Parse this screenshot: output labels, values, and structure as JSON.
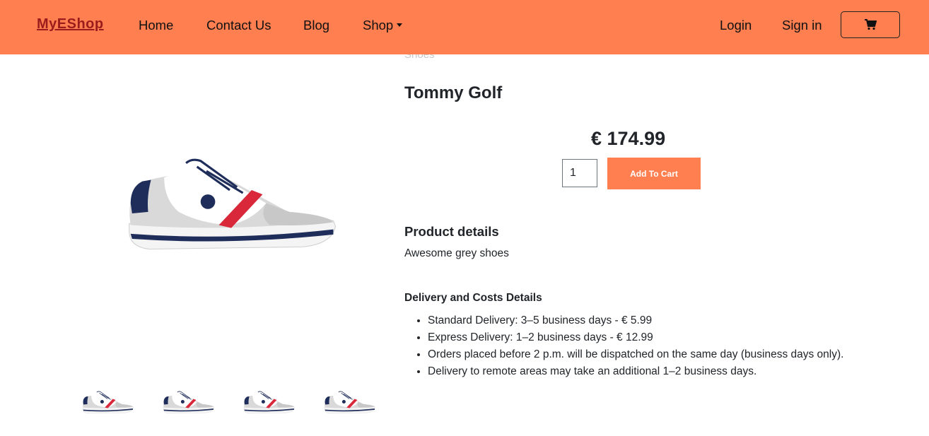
{
  "nav": {
    "brand": "MyEShop",
    "links": [
      "Home",
      "Contact Us",
      "Blog",
      "Shop"
    ],
    "login": "Login",
    "signin": "Sign in",
    "cart_icon": "shopping-cart-icon"
  },
  "breadcrumb": "Shoes",
  "product": {
    "title": "Tommy Golf",
    "price": "€ 174.99",
    "quantity": "1",
    "add_to_cart_label": "Add To Cart",
    "details_heading": "Product details",
    "description": "Awesome grey shoes",
    "delivery_heading": "Delivery and Costs Details",
    "delivery_items": [
      "Standard Delivery: 3–5 business days - € 5.99",
      "Express Delivery: 1–2 business days - € 12.99",
      "Orders placed before 2 p.m. will be dispatched on the same day (business days only).",
      "Delivery to remote areas may take an additional 1–2 business days."
    ]
  },
  "colors": {
    "navbar": "#ff7f50",
    "brand": "#9b1c1c",
    "accent_button": "#ff7f50"
  }
}
